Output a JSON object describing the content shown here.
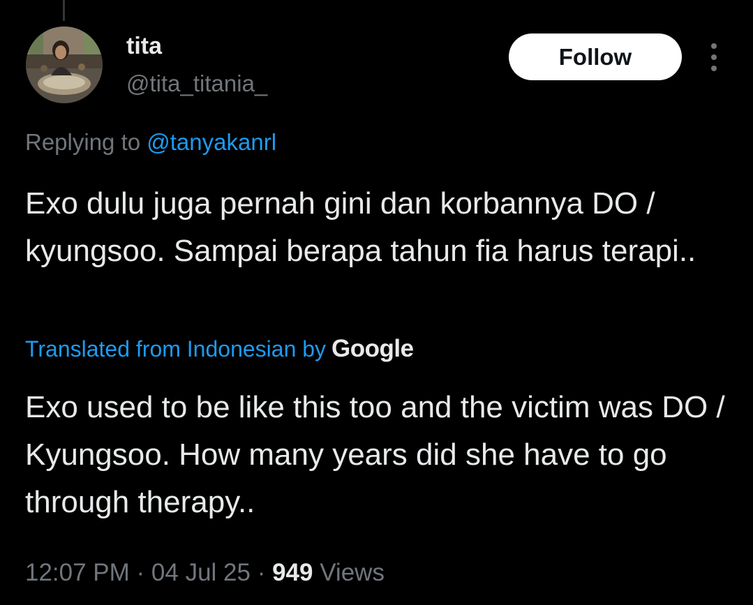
{
  "author": {
    "display_name": "tita",
    "handle": "@tita_titania_",
    "avatar_icon": "profile-photo"
  },
  "actions": {
    "follow_label": "Follow",
    "more_icon": "more-options-icon"
  },
  "reply": {
    "prefix": "Replying to ",
    "mention": "@tanyakanrl"
  },
  "tweet": {
    "text": "Exo dulu juga pernah gini dan korbannya DO / kyungsoo. Sampai berapa tahun fia harus terapi.."
  },
  "translation": {
    "label": "Translated from Indonesian by",
    "provider": "Google",
    "text": "Exo used to be like this too and the victim was DO / Kyungsoo. How many years did she have to go through therapy.."
  },
  "meta": {
    "time": "12:07 PM",
    "separator": " · ",
    "date": "04 Jul 25",
    "views_count": "949",
    "views_label": " Views"
  },
  "colors": {
    "background": "#000000",
    "text_primary": "#e7e9ea",
    "text_secondary": "#71767b",
    "accent": "#1d9bf0",
    "button_bg": "#ffffff"
  }
}
